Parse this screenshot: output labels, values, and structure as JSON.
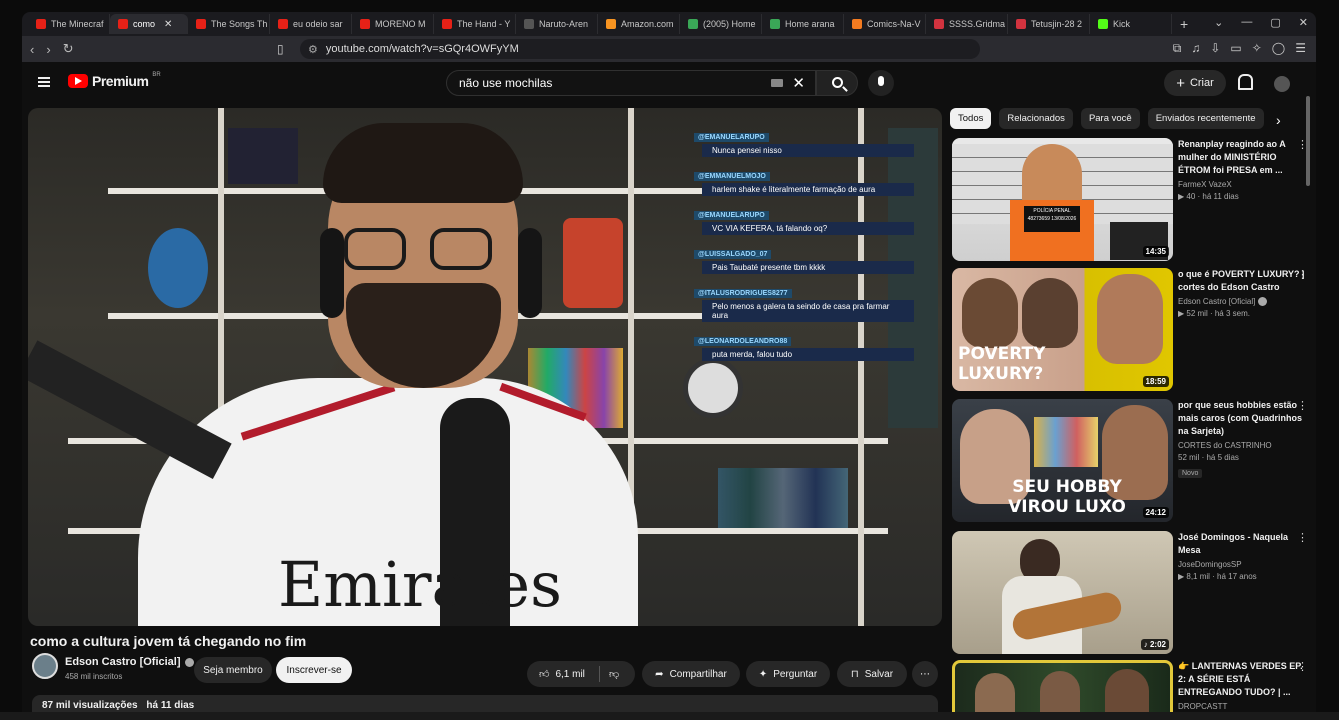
{
  "browser": {
    "tabs": [
      {
        "label": "The Minecraf",
        "color": "#e62117"
      },
      {
        "label": "como",
        "color": "#e62117",
        "active": true
      },
      {
        "label": "The Songs Th",
        "color": "#e62117"
      },
      {
        "label": "eu odeio sar",
        "color": "#e62117"
      },
      {
        "label": "MORENO M",
        "color": "#e62117"
      },
      {
        "label": "The Hand - Y",
        "color": "#e62117"
      },
      {
        "label": "Naruto-Aren",
        "color": "#555"
      },
      {
        "label": "Amazon.com",
        "color": "#f79421"
      },
      {
        "label": "(2005) Home",
        "color": "#3aa757"
      },
      {
        "label": "Home arana",
        "color": "#3aa757"
      },
      {
        "label": "Comics-Na-V",
        "color": "#f47b20"
      },
      {
        "label": "SSSS.Gridma",
        "color": "#d2333f"
      },
      {
        "label": "Tetusjin-28 2",
        "color": "#d2333f"
      },
      {
        "label": "Kick",
        "color": "#53fc18"
      }
    ],
    "tab_close": "✕",
    "new_tab": "+",
    "url": "youtube.com/watch?v=sGQr4OWFyYM"
  },
  "header": {
    "logo_text": "Premium",
    "logo_region": "BR",
    "search_value": "não use mochilas",
    "create_label": "Criar"
  },
  "chat": [
    {
      "user": "@EMANUELARUPO",
      "text": "Nunca pensei nisso"
    },
    {
      "user": "@EMMANUELMOJO",
      "text": "harlem shake é literalmente farmação de aura"
    },
    {
      "user": "@EMANUELARUPO",
      "text": "VC VIA KEFERA, tá falando oq?"
    },
    {
      "user": "@LUISSALGADO_07",
      "text": "Pais Taubaté presente tbm kkkk"
    },
    {
      "user": "@ITALUSRODRIGUES8277",
      "text": "Pelo menos a galera ta seindo de casa pra farmar aura"
    },
    {
      "user": "@LEONARDOLEANDRO88",
      "text": "puta merda, falou tudo"
    }
  ],
  "video": {
    "title": "como a cultura jovem tá chegando no fim",
    "channel": "Edson Castro [Oficial]",
    "subscribers": "458 mil inscritos",
    "member_label": "Seja membro",
    "subscribe_label": "Inscrever-se",
    "likes": "6,1 mil",
    "share_label": "Compartilhar",
    "ask_label": "Perguntar",
    "save_label": "Salvar",
    "views": "87 mil visualizações",
    "age": "há 11 dias",
    "shirt_text": "Emirates"
  },
  "sidebar": {
    "chips": [
      "Todos",
      "Relacionados",
      "Para você",
      "Enviados recentemente"
    ],
    "recommendations": [
      {
        "title": "Renanplay reagindo ao  A mulher do MINISTÉRIO ÉTROM foi PRESA em ...",
        "channel": "FarmeX VazeX",
        "views": "40",
        "age": "há 11 dias",
        "duration": "14:35",
        "thumb_caption": "POLÍCIA PENAL 48273659 13/08/2026"
      },
      {
        "title": "o que é POVERTY LUXURY? | cortes do Edson Castro",
        "channel": "Edson Castro [Oficial]",
        "views": "52 mil",
        "age": "há 3 sem.",
        "duration": "18:59",
        "thumb_text": "POVERTY LUXURY?"
      },
      {
        "title": "por que seus hobbies estão mais caros (com Quadrinhos na Sarjeta)",
        "channel": "CORTES do CASTRINHO",
        "views": "52 mil",
        "age": "há 5 dias",
        "duration": "24:12",
        "badge": "Novo",
        "thumb_text": "SEU HOBBY VIROU LUXO"
      },
      {
        "title": "José Domingos -  Naquela Mesa",
        "channel": "JoseDomingosSP",
        "views": "8,1 mil",
        "age": "há 17 anos",
        "duration": "2:02"
      },
      {
        "title": "👉 LANTERNAS VERDES EP. 2: A SÉRIE ESTÁ ENTREGANDO TUDO? | ...",
        "channel": "DROPCASTT",
        "views": "",
        "age": "",
        "duration": ""
      }
    ]
  }
}
